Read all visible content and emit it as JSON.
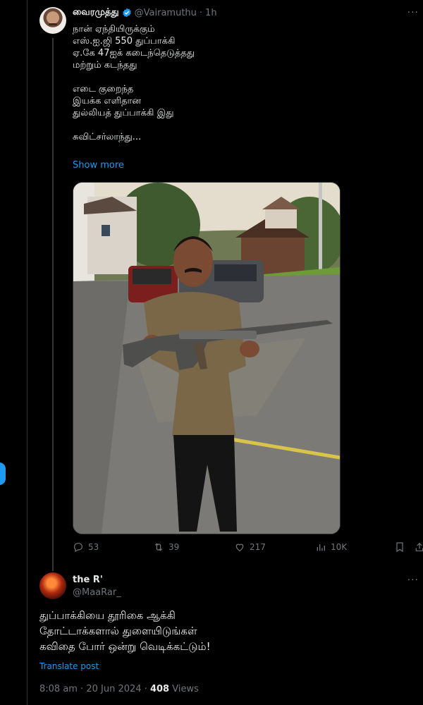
{
  "tweet": {
    "author_name": "வைரமுத்து",
    "handle": "@Vairamuthu",
    "separator": "·",
    "time": "1h",
    "lines": [
      "நான் ஏந்தியிருக்கும்",
      "எஸ்.ஐ.ஜி 550 துப்பாக்கி",
      "ஏ.கே 47ஐக் கடைந்தெடுத்தது",
      "மற்றும் கடந்தது",
      "",
      "எடை குறைந்த",
      "இயக்க எளிதான",
      "துல்லியத் துப்பாக்கி இது",
      "",
      "சுவிட்சர்லாந்து..."
    ],
    "show_more": "Show more",
    "stats": {
      "replies": "53",
      "reposts": "39",
      "likes": "217",
      "views": "10K"
    },
    "more_icon": "more-dots-icon"
  },
  "reply": {
    "author_name": "the R'",
    "handle": "@MaaRar_",
    "lines": [
      "துப்பாக்கியை தூரிகை ஆக்கி",
      "தோட்டாக்களால் துளையிடுங்கள்",
      "கவிதை போர் ஒன்று வெடிக்கட்டும்!"
    ],
    "translate": "Translate post",
    "time": "8:08 am · 20 Jun 2024 · ",
    "views_count": "408",
    "views_label": " Views"
  },
  "colors": {
    "accent": "#1d9bf0",
    "muted": "#71767b",
    "text": "#e7e9ea",
    "background": "#000000"
  }
}
